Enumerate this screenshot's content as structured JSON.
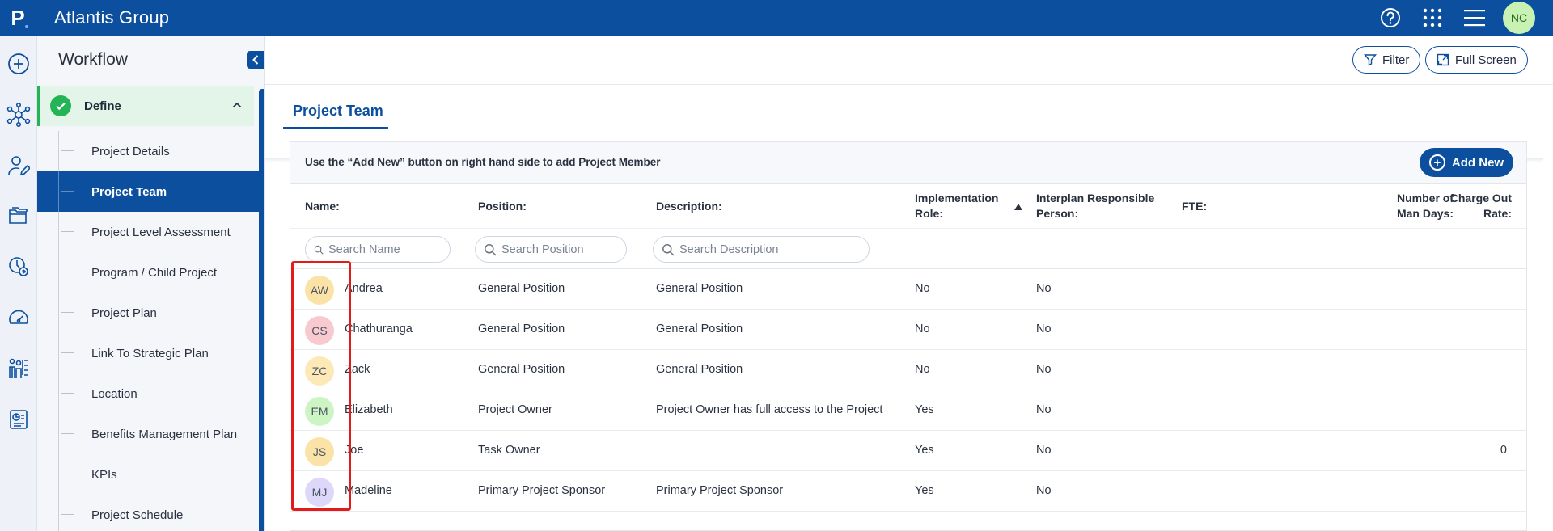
{
  "app": {
    "logo_letter": "P",
    "company_name": "Atlantis Group",
    "user_initials": "NC",
    "colors": {
      "brand": "#0b4f9e",
      "success": "#22b455",
      "highlight": "#e41b1b"
    }
  },
  "topbar_icons": [
    "help-icon",
    "apps-grid-icon",
    "hamburger-menu-icon"
  ],
  "rail_icons": [
    "add-circle-icon",
    "network-icon",
    "user-edit-icon",
    "folders-icon",
    "finance-clock-icon",
    "speedometer-icon",
    "people-hierarchy-icon",
    "report-icon"
  ],
  "workflow": {
    "title": "Workflow",
    "section_label": "Define",
    "steps": [
      "Project Details",
      "Project Team",
      "Project Level Assessment",
      "Program / Child Project",
      "Project Plan",
      "Link To Strategic Plan",
      "Location",
      "Benefits Management Plan",
      "KPIs",
      "Project Schedule"
    ],
    "active_step": "Project Team"
  },
  "toolbar": {
    "filter_label": "Filter",
    "fullscreen_label": "Full Screen"
  },
  "tab": {
    "label": "Project Team"
  },
  "table": {
    "hint": "Use the “Add New” button on right hand side to add Project Member",
    "add_label": "Add New",
    "columns": {
      "name": "Name:",
      "position": "Position:",
      "description": "Description:",
      "impl_role_1": "Implementation",
      "impl_role_2": "Role:",
      "interplan_1": "Interplan Responsible",
      "interplan_2": "Person:",
      "fte": "FTE:",
      "man_days_1": "Number of",
      "man_days_2": "Man Days:",
      "charge_1": "Charge Out",
      "charge_2": "Rate:"
    },
    "search": {
      "name_placeholder": "Search Name",
      "position_placeholder": "Search Position",
      "description_placeholder": "Search Description"
    },
    "rows": [
      {
        "initials": "AW",
        "avatar_color": "#fbe3a8",
        "name": "Andrea",
        "position": "General Position",
        "description": "General Position",
        "impl_role": "No",
        "interplan": "No",
        "fte": "",
        "man_days": "",
        "charge": ""
      },
      {
        "initials": "CS",
        "avatar_color": "#f8c9cf",
        "name": "Chathuranga",
        "position": "General Position",
        "description": "General Position",
        "impl_role": "No",
        "interplan": "No",
        "fte": "",
        "man_days": "",
        "charge": ""
      },
      {
        "initials": "ZC",
        "avatar_color": "#fde8b8",
        "name": "Zack",
        "position": "General Position",
        "description": "General Position",
        "impl_role": "No",
        "interplan": "No",
        "fte": "",
        "man_days": "",
        "charge": ""
      },
      {
        "initials": "EM",
        "avatar_color": "#cdf5c4",
        "name": "Elizabeth",
        "position": "Project Owner",
        "description": "Project Owner has full access to the Project",
        "impl_role": "Yes",
        "interplan": "No",
        "fte": "",
        "man_days": "",
        "charge": ""
      },
      {
        "initials": "JS",
        "avatar_color": "#fbe3a8",
        "name": "Joe",
        "position": "Task Owner",
        "description": "",
        "impl_role": "Yes",
        "interplan": "No",
        "fte": "",
        "man_days": "",
        "charge": "0"
      },
      {
        "initials": "MJ",
        "avatar_color": "#ddd8fa",
        "name": "Madeline",
        "position": "Primary Project Sponsor",
        "description": "Primary Project Sponsor",
        "impl_role": "Yes",
        "interplan": "No",
        "fte": "",
        "man_days": "",
        "charge": ""
      }
    ]
  }
}
